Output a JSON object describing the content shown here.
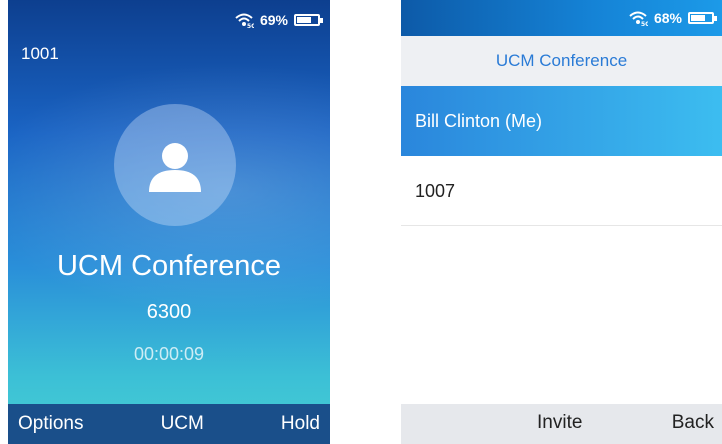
{
  "left_phone": {
    "status": {
      "battery_text": "69%",
      "battery_level": 0.69
    },
    "account": "1001",
    "call": {
      "name": "UCM Conference",
      "number": "6300",
      "timer": "00:00:09"
    },
    "softkeys": {
      "left": "Options",
      "center": "UCM",
      "right": "Hold"
    },
    "icons": {
      "wifi": "wifi-5g-icon",
      "battery": "battery-icon",
      "avatar": "person-icon"
    },
    "colors": {
      "softkey_bar": "#1a4f8a",
      "accent": "#2a8fd9"
    }
  },
  "right_phone": {
    "status": {
      "battery_text": "68%",
      "battery_level": 0.68
    },
    "title": "UCM Conference",
    "participants": [
      {
        "label": "Bill Clinton (Me)",
        "selected": true
      },
      {
        "label": "1007",
        "selected": false
      }
    ],
    "softkeys": {
      "center": "Invite",
      "right": "Back"
    },
    "colors": {
      "title_text": "#2a7bd6",
      "selected_row": "#2a86dc"
    }
  }
}
